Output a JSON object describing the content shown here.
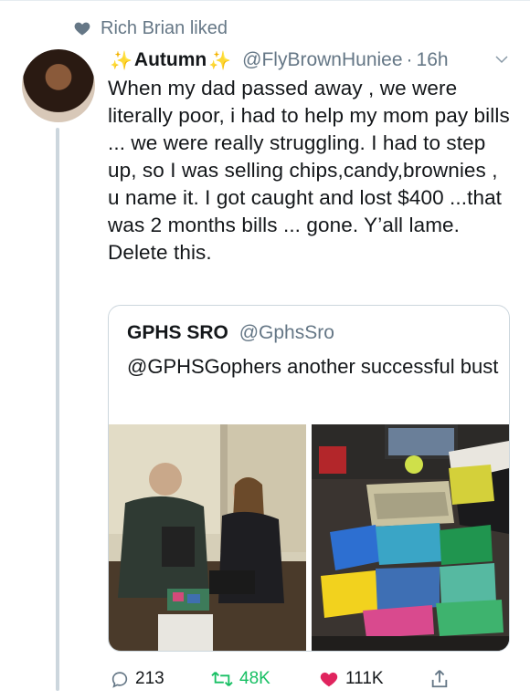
{
  "social_context": {
    "text": "Rich Brian liked"
  },
  "tweet": {
    "sparkle": "✨",
    "display_name": "Autumn",
    "handle": "@FlyBrownHuniee",
    "separator": "·",
    "time": "16h",
    "text": "When my dad passed away , we were literally poor, i had to help my mom pay bills ... we were really struggling. I had to step up, so I was selling chips,candy,brownies , u name it. I got caught and lost $400 ...that was 2 months bills ... gone. Y’all lame. Delete this."
  },
  "quoted_tweet": {
    "display_name": "GPHS SRO",
    "handle": "@GphsSro",
    "text": "@GPHSGophers another successful bust"
  },
  "actions": {
    "reply_count": "213",
    "retweet_count": "48K",
    "like_count": "111K"
  },
  "colors": {
    "secondary_text": "#657786",
    "retweet_green": "#17bf63",
    "like_red": "#e0245e",
    "border": "#ccd6dd"
  }
}
